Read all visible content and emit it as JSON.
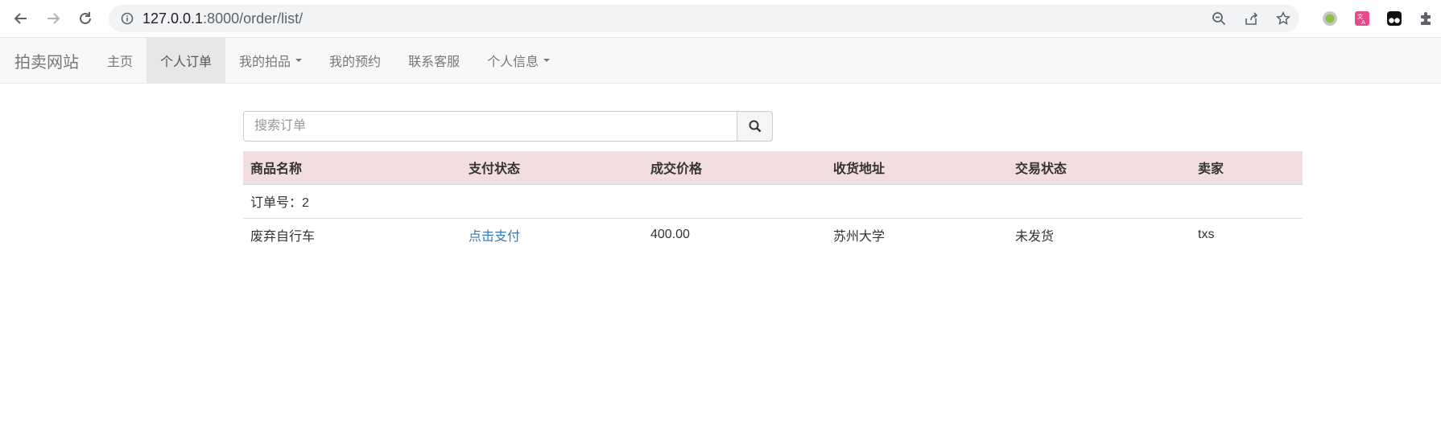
{
  "browser": {
    "url_host": "127.0.0.1",
    "url_rest": ":8000/order/list/"
  },
  "navbar": {
    "brand": "拍卖网站",
    "items": [
      {
        "label": "主页",
        "active": false,
        "dropdown": false
      },
      {
        "label": "个人订单",
        "active": true,
        "dropdown": false
      },
      {
        "label": "我的拍品",
        "active": false,
        "dropdown": true
      },
      {
        "label": "我的预约",
        "active": false,
        "dropdown": false
      },
      {
        "label": "联系客服",
        "active": false,
        "dropdown": false
      },
      {
        "label": "个人信息",
        "active": false,
        "dropdown": true
      }
    ]
  },
  "search": {
    "placeholder": "搜索订单",
    "value": ""
  },
  "table": {
    "headers": [
      "商品名称",
      "支付状态",
      "成交价格",
      "收货地址",
      "交易状态",
      "卖家"
    ],
    "order_label": "订单号：2",
    "rows": [
      {
        "name": "废弃自行车",
        "pay_status": "点击支付",
        "price": "400.00",
        "address": "苏州大学",
        "trade_status": "未发货",
        "seller": "txs"
      }
    ]
  },
  "colors": {
    "header_bg": "#f2dede",
    "link": "#337ab7",
    "navbar_bg": "#f8f8f8"
  }
}
